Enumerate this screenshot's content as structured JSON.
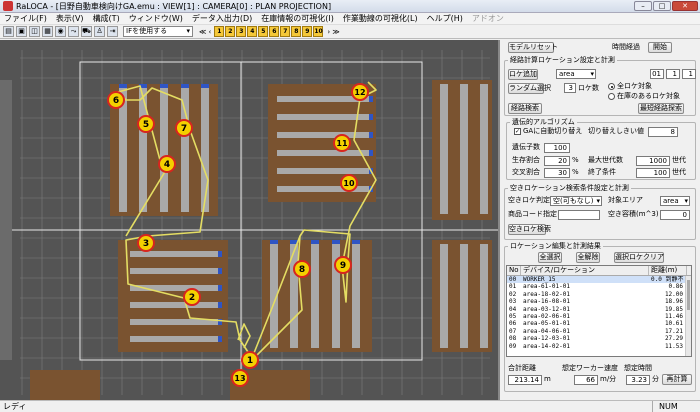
{
  "window": {
    "title": "RaLOCA - [日野自動車検向けGA.emu : VIEW[1] : CAMERA[0] : PLAN PROJECTION]"
  },
  "menu": [
    {
      "label": "ファイル(F)",
      "disabled": false
    },
    {
      "label": "表示(V)",
      "disabled": false
    },
    {
      "label": "構成(T)",
      "disabled": false
    },
    {
      "label": "ウィンドウ(W)",
      "disabled": false
    },
    {
      "label": "データ入出力(D)",
      "disabled": false
    },
    {
      "label": "在庫情報の可視化(I)",
      "disabled": false
    },
    {
      "label": "作業動線の可視化(L)",
      "disabled": false
    },
    {
      "label": "ヘルプ(H)",
      "disabled": false
    },
    {
      "label": "アドオン",
      "disabled": true
    }
  ],
  "toolbar": {
    "if_select": "IFを使用する",
    "nav_prev": "≪ ‹",
    "nav_next": "› ≫",
    "numbers": [
      "1",
      "2",
      "3",
      "4",
      "5",
      "6",
      "7",
      "8",
      "9",
      "10"
    ]
  },
  "markers": [
    "1",
    "2",
    "3",
    "4",
    "5",
    "6",
    "7",
    "8",
    "9",
    "10",
    "11",
    "12",
    "13"
  ],
  "colors": {
    "floor": "#545454",
    "rack": "#7a5330",
    "shelf": "#a9a9a9",
    "route": "#e4dd63",
    "marker_fill": "#f4d000",
    "marker_ring": "#d7261e",
    "pick": "#2f55c4"
  },
  "panel": {
    "model_reset": "モデルリセット",
    "time_label": "時間経過",
    "start": "開始",
    "route_group": "経路計算ロケーション設定と計測",
    "location_add": "ロケ追加",
    "area_select": "area",
    "loc_values": [
      "01",
      "1",
      "1"
    ],
    "random_select": "ランダム選択",
    "random_count": "3",
    "random_unit": "ロケ数",
    "radio_all": "全ロケ対象",
    "radio_stock": "在庫のあるロケ対象",
    "route_search": "経路検索",
    "optimal_search": "最短経路探索",
    "ga_group": "遺伝的アルゴリズム",
    "ga_auto": "GAに自動切り替え",
    "switch_threshold_label": "切り替えしきい値",
    "switch_threshold": "8",
    "genes_label": "遺伝子数",
    "genes": "100",
    "survival_label": "生存割合",
    "survival": "20",
    "max_gen_label": "最大世代数",
    "max_gen": "1000",
    "crossover_label": "交叉割合",
    "crossover": "30",
    "end_cond_label": "終了条件",
    "end_cond": "100",
    "percent": "%",
    "generation": "世代",
    "empty_group": "空きロケーション検索条件設定と計測",
    "empty_judge_label": "空きロケ判定",
    "empty_judge": "空(可もなし)",
    "target_area_label": "対象エリア",
    "target_area": "area",
    "product_code_label": "商品コード指定",
    "capacity_label": "空き容積(m^3)",
    "capacity": "0",
    "empty_search": "空きロケ検索",
    "edit_group": "ロケーション編集と計測結果",
    "select_all": "全選択",
    "deselect_all": "全解除",
    "clear_selected": "選択ロケクリア",
    "table_headers": [
      "No",
      "デバイス/ロケーション",
      "距離(m)"
    ],
    "rows": [
      [
        "00",
        "WORKER_15",
        "0.0 到静不"
      ],
      [
        "01",
        "area-61-01-01",
        "0.86"
      ],
      [
        "02",
        "area-18-02-01",
        "12.00"
      ],
      [
        "03",
        "area-16-08-01",
        "18.96"
      ],
      [
        "04",
        "area-03-12-01",
        "19.85"
      ],
      [
        "05",
        "area-02-06-01",
        "11.46"
      ],
      [
        "06",
        "area-05-01-01",
        "10.61"
      ],
      [
        "07",
        "area-04-06-01",
        "17.21"
      ],
      [
        "08",
        "area-12-03-01",
        "27.29"
      ],
      [
        "09",
        "area-14-02-01",
        "11.53"
      ]
    ],
    "total_label": "合計距離",
    "total": "213.14",
    "total_unit": "m",
    "speed_label": "想定ワーカー速度",
    "speed": "66",
    "speed_unit": "m/分",
    "time_est_label": "想定時間",
    "time_est": "3.23",
    "time_unit": "分",
    "recalc": "再計算"
  },
  "status": {
    "ready": "レディ",
    "num": "NUM"
  }
}
